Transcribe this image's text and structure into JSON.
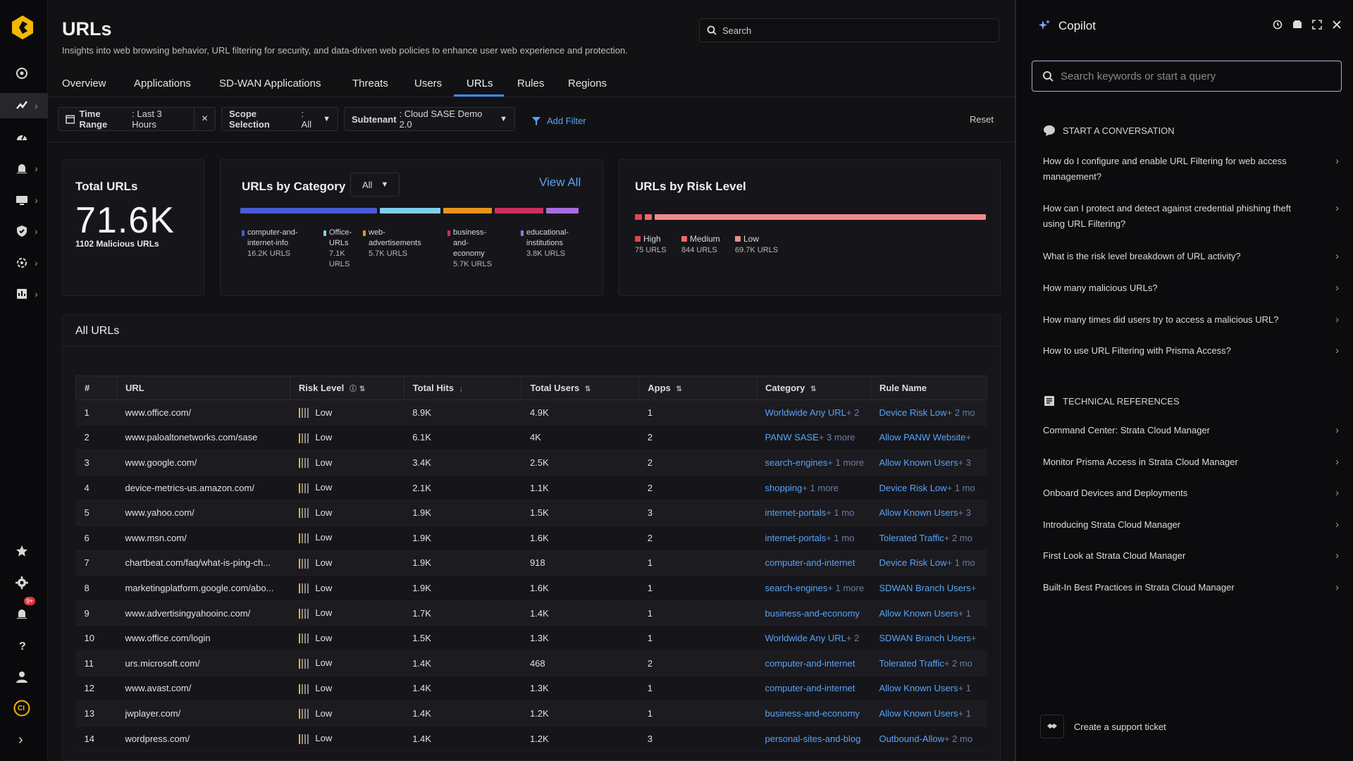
{
  "header": {
    "title": "URLs",
    "subtitle": "Insights into web browsing behavior, URL filtering for security, and data-driven web policies to enhance user web experience and protection.",
    "search_placeholder": "Search"
  },
  "tabs": [
    "Overview",
    "Applications",
    "SD-WAN Applications",
    "Threats",
    "Users",
    "URLs",
    "Rules",
    "Regions"
  ],
  "active_tab": "URLs",
  "filters": {
    "time_range": {
      "label": "Time Range",
      "value": ": Last 3 Hours"
    },
    "scope": {
      "label": "Scope Selection",
      "value": ": All"
    },
    "subtenant": {
      "label": "Subtenant",
      "value": ": Cloud SASE Demo 2.0"
    },
    "add_filter": "Add Filter",
    "reset": "Reset"
  },
  "total_urls": {
    "title": "Total URLs",
    "value": "71.6K",
    "malicious": "1102 Malicious URLs"
  },
  "by_category": {
    "title": "URLs by Category",
    "select_value": "All",
    "view_all": "View All",
    "items": [
      {
        "lines": [
          "computer-and-",
          "internet-info"
        ],
        "count": "16.2K URLS",
        "color": "#4a5bd6"
      },
      {
        "lines": [
          "Office-",
          "URLs"
        ],
        "count": "7.1K URLS",
        "color": "#7fd0ee"
      },
      {
        "lines": [
          "web-",
          "advertisements"
        ],
        "count": "5.7K URLS",
        "color": "#e9941c"
      },
      {
        "lines": [
          "business-",
          "and-",
          "economy"
        ],
        "count": "5.7K URLS",
        "color": "#c9305f"
      },
      {
        "lines": [
          "educational-",
          "institutions"
        ],
        "count": "3.8K URLS",
        "color": "#a86ee0"
      }
    ]
  },
  "by_risk": {
    "title": "URLs by Risk Level",
    "items": [
      {
        "label": "High",
        "count": "75 URLS",
        "color": "#e0474a"
      },
      {
        "label": "Medium",
        "count": "844 URLS",
        "color": "#ef6a6a"
      },
      {
        "label": "Low",
        "count": "69.7K URLS",
        "color": "#f08a8a"
      }
    ]
  },
  "all_urls": {
    "title": "All URLs",
    "columns": [
      "#",
      "URL",
      "Risk Level",
      "Total Hits",
      "Total Users",
      "Apps",
      "Category",
      "Rule Name"
    ],
    "rows": [
      [
        "1",
        "www.office.com/",
        "Low",
        "8.9K",
        "4.9K",
        "1",
        "Worldwide Any URL",
        "+ 2",
        "Device Risk Low",
        "+ 2 mo"
      ],
      [
        "2",
        "www.paloaltonetworks.com/sase",
        "Low",
        "6.1K",
        "4K",
        "2",
        "PANW SASE",
        "+ 3 more",
        "Allow PANW Website",
        "+"
      ],
      [
        "3",
        "www.google.com/",
        "Low",
        "3.4K",
        "2.5K",
        "2",
        "search-engines",
        "+ 1 more",
        "Allow Known Users",
        "+ 3"
      ],
      [
        "4",
        "device-metrics-us.amazon.com/",
        "Low",
        "2.1K",
        "1.1K",
        "2",
        "shopping",
        "+ 1 more",
        "Device Risk Low",
        "+ 1 mo"
      ],
      [
        "5",
        "www.yahoo.com/",
        "Low",
        "1.9K",
        "1.5K",
        "3",
        "internet-portals",
        "+ 1 mo",
        "Allow Known Users",
        "+ 3"
      ],
      [
        "6",
        "www.msn.com/",
        "Low",
        "1.9K",
        "1.6K",
        "2",
        "internet-portals",
        "+ 1 mo",
        "Tolerated Traffic",
        "+ 2 mo"
      ],
      [
        "7",
        "chartbeat.com/faq/what-is-ping-ch...",
        "Low",
        "1.9K",
        "918",
        "1",
        "computer-and-internet",
        "",
        "Device Risk Low",
        "+ 1 mo"
      ],
      [
        "8",
        "marketingplatform.google.com/abo...",
        "Low",
        "1.9K",
        "1.6K",
        "1",
        "search-engines",
        "+ 1 more",
        "SDWAN Branch Users",
        "+"
      ],
      [
        "9",
        "www.advertisingyahooinc.com/",
        "Low",
        "1.7K",
        "1.4K",
        "1",
        "business-and-economy",
        "",
        "Allow Known Users",
        "+ 1"
      ],
      [
        "10",
        "www.office.com/login",
        "Low",
        "1.5K",
        "1.3K",
        "1",
        "Worldwide Any URL",
        "+ 2",
        "SDWAN Branch Users",
        "+"
      ],
      [
        "11",
        "urs.microsoft.com/",
        "Low",
        "1.4K",
        "468",
        "2",
        "computer-and-internet",
        "",
        "Tolerated Traffic",
        "+ 2 mo"
      ],
      [
        "12",
        "www.avast.com/",
        "Low",
        "1.4K",
        "1.3K",
        "1",
        "computer-and-internet",
        "",
        "Allow Known Users",
        "+ 1"
      ],
      [
        "13",
        "jwplayer.com/",
        "Low",
        "1.4K",
        "1.2K",
        "1",
        "business-and-economy",
        "",
        "Allow Known Users",
        "+ 1"
      ],
      [
        "14",
        "wordpress.com/",
        "Low",
        "1.4K",
        "1.2K",
        "3",
        "personal-sites-and-blog",
        "",
        "Outbound-Allow",
        "+ 2 mo"
      ]
    ]
  },
  "copilot": {
    "title": "Copilot",
    "search_placeholder": "Search keywords or start a query",
    "start_title": "START A CONVERSATION",
    "questions": [
      "How do I configure and enable URL Filtering for web access management?",
      "How can I protect and detect against credential phishing theft using URL Filtering?",
      "What is the risk level breakdown of URL activity?",
      "How many malicious URLs?",
      "How many times did users try to access a malicious URL?",
      "How to use URL Filtering with Prisma Access?"
    ],
    "refs_title": "TECHNICAL REFERENCES",
    "refs": [
      "Command Center: Strata Cloud Manager",
      "Monitor Prisma Access in Strata Cloud Manager",
      "Onboard Devices and Deployments",
      "Introducing Strata Cloud Manager",
      "First Look at Strata Cloud Manager",
      "Built-In Best Practices in Strata Cloud Manager"
    ],
    "support": "Create a support ticket"
  },
  "rail": {
    "notif_badge": "9+",
    "avatar_initials": "CI"
  }
}
